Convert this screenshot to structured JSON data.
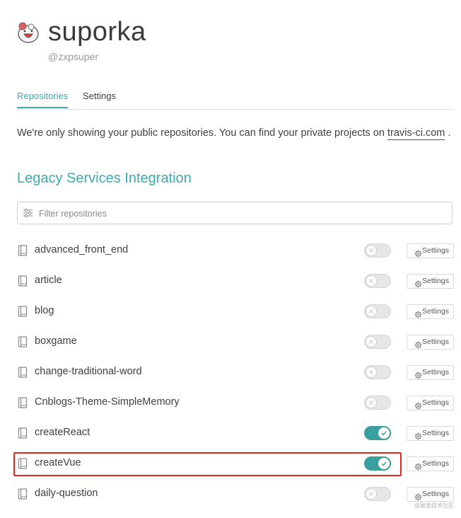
{
  "profile": {
    "username": "suporka",
    "handle": "@zxpsuper"
  },
  "tabs": {
    "repositories": "Repositories",
    "settings": "Settings"
  },
  "notice": {
    "text": "We're only showing your public repositories. You can find your private projects on ",
    "link": "travis-ci.com",
    "suffix": " ."
  },
  "section_title": "Legacy Services Integration",
  "filter": {
    "placeholder": "Filter repositories",
    "icon": "sliders-icon"
  },
  "repositories": [
    {
      "name": "advanced_front_end",
      "enabled": false
    },
    {
      "name": "article",
      "enabled": false
    },
    {
      "name": "blog",
      "enabled": false
    },
    {
      "name": "boxgame",
      "enabled": false
    },
    {
      "name": "change-traditional-word",
      "enabled": false
    },
    {
      "name": "Cnblogs-Theme-SimpleMemory",
      "enabled": false
    },
    {
      "name": "createReact",
      "enabled": true
    },
    {
      "name": "createVue",
      "enabled": true,
      "highlighted": true
    },
    {
      "name": "daily-question",
      "enabled": false
    }
  ],
  "settings_label": "Settings",
  "watermark": "@掘金技术社区",
  "colors": {
    "accent": "#3eaaaf",
    "toggle_on": "#3a9f9d",
    "highlight": "#e0271f"
  }
}
